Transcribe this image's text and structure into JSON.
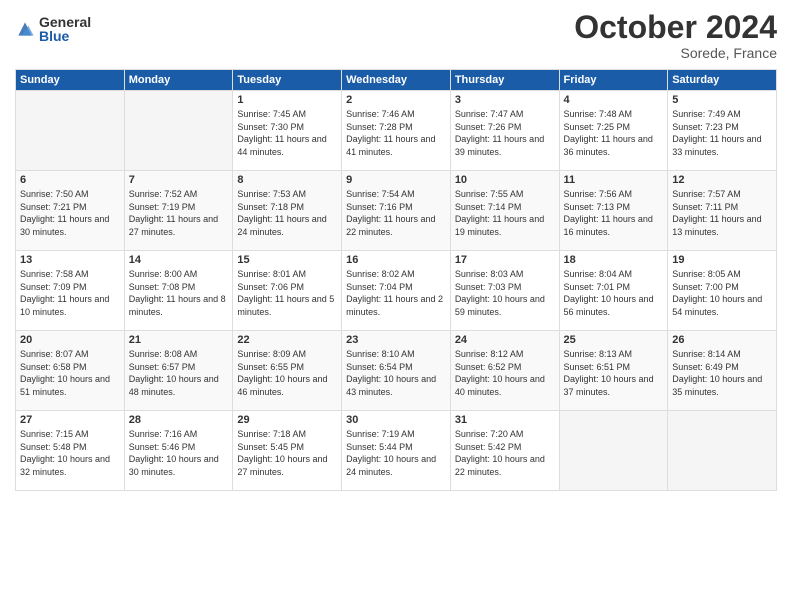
{
  "header": {
    "logo_general": "General",
    "logo_blue": "Blue",
    "month_title": "October 2024",
    "location": "Sorede, France"
  },
  "days_of_week": [
    "Sunday",
    "Monday",
    "Tuesday",
    "Wednesday",
    "Thursday",
    "Friday",
    "Saturday"
  ],
  "weeks": [
    [
      {
        "day": "",
        "empty": true
      },
      {
        "day": "",
        "empty": true
      },
      {
        "day": "1",
        "sunrise": "Sunrise: 7:45 AM",
        "sunset": "Sunset: 7:30 PM",
        "daylight": "Daylight: 11 hours and 44 minutes."
      },
      {
        "day": "2",
        "sunrise": "Sunrise: 7:46 AM",
        "sunset": "Sunset: 7:28 PM",
        "daylight": "Daylight: 11 hours and 41 minutes."
      },
      {
        "day": "3",
        "sunrise": "Sunrise: 7:47 AM",
        "sunset": "Sunset: 7:26 PM",
        "daylight": "Daylight: 11 hours and 39 minutes."
      },
      {
        "day": "4",
        "sunrise": "Sunrise: 7:48 AM",
        "sunset": "Sunset: 7:25 PM",
        "daylight": "Daylight: 11 hours and 36 minutes."
      },
      {
        "day": "5",
        "sunrise": "Sunrise: 7:49 AM",
        "sunset": "Sunset: 7:23 PM",
        "daylight": "Daylight: 11 hours and 33 minutes."
      }
    ],
    [
      {
        "day": "6",
        "sunrise": "Sunrise: 7:50 AM",
        "sunset": "Sunset: 7:21 PM",
        "daylight": "Daylight: 11 hours and 30 minutes."
      },
      {
        "day": "7",
        "sunrise": "Sunrise: 7:52 AM",
        "sunset": "Sunset: 7:19 PM",
        "daylight": "Daylight: 11 hours and 27 minutes."
      },
      {
        "day": "8",
        "sunrise": "Sunrise: 7:53 AM",
        "sunset": "Sunset: 7:18 PM",
        "daylight": "Daylight: 11 hours and 24 minutes."
      },
      {
        "day": "9",
        "sunrise": "Sunrise: 7:54 AM",
        "sunset": "Sunset: 7:16 PM",
        "daylight": "Daylight: 11 hours and 22 minutes."
      },
      {
        "day": "10",
        "sunrise": "Sunrise: 7:55 AM",
        "sunset": "Sunset: 7:14 PM",
        "daylight": "Daylight: 11 hours and 19 minutes."
      },
      {
        "day": "11",
        "sunrise": "Sunrise: 7:56 AM",
        "sunset": "Sunset: 7:13 PM",
        "daylight": "Daylight: 11 hours and 16 minutes."
      },
      {
        "day": "12",
        "sunrise": "Sunrise: 7:57 AM",
        "sunset": "Sunset: 7:11 PM",
        "daylight": "Daylight: 11 hours and 13 minutes."
      }
    ],
    [
      {
        "day": "13",
        "sunrise": "Sunrise: 7:58 AM",
        "sunset": "Sunset: 7:09 PM",
        "daylight": "Daylight: 11 hours and 10 minutes."
      },
      {
        "day": "14",
        "sunrise": "Sunrise: 8:00 AM",
        "sunset": "Sunset: 7:08 PM",
        "daylight": "Daylight: 11 hours and 8 minutes."
      },
      {
        "day": "15",
        "sunrise": "Sunrise: 8:01 AM",
        "sunset": "Sunset: 7:06 PM",
        "daylight": "Daylight: 11 hours and 5 minutes."
      },
      {
        "day": "16",
        "sunrise": "Sunrise: 8:02 AM",
        "sunset": "Sunset: 7:04 PM",
        "daylight": "Daylight: 11 hours and 2 minutes."
      },
      {
        "day": "17",
        "sunrise": "Sunrise: 8:03 AM",
        "sunset": "Sunset: 7:03 PM",
        "daylight": "Daylight: 10 hours and 59 minutes."
      },
      {
        "day": "18",
        "sunrise": "Sunrise: 8:04 AM",
        "sunset": "Sunset: 7:01 PM",
        "daylight": "Daylight: 10 hours and 56 minutes."
      },
      {
        "day": "19",
        "sunrise": "Sunrise: 8:05 AM",
        "sunset": "Sunset: 7:00 PM",
        "daylight": "Daylight: 10 hours and 54 minutes."
      }
    ],
    [
      {
        "day": "20",
        "sunrise": "Sunrise: 8:07 AM",
        "sunset": "Sunset: 6:58 PM",
        "daylight": "Daylight: 10 hours and 51 minutes."
      },
      {
        "day": "21",
        "sunrise": "Sunrise: 8:08 AM",
        "sunset": "Sunset: 6:57 PM",
        "daylight": "Daylight: 10 hours and 48 minutes."
      },
      {
        "day": "22",
        "sunrise": "Sunrise: 8:09 AM",
        "sunset": "Sunset: 6:55 PM",
        "daylight": "Daylight: 10 hours and 46 minutes."
      },
      {
        "day": "23",
        "sunrise": "Sunrise: 8:10 AM",
        "sunset": "Sunset: 6:54 PM",
        "daylight": "Daylight: 10 hours and 43 minutes."
      },
      {
        "day": "24",
        "sunrise": "Sunrise: 8:12 AM",
        "sunset": "Sunset: 6:52 PM",
        "daylight": "Daylight: 10 hours and 40 minutes."
      },
      {
        "day": "25",
        "sunrise": "Sunrise: 8:13 AM",
        "sunset": "Sunset: 6:51 PM",
        "daylight": "Daylight: 10 hours and 37 minutes."
      },
      {
        "day": "26",
        "sunrise": "Sunrise: 8:14 AM",
        "sunset": "Sunset: 6:49 PM",
        "daylight": "Daylight: 10 hours and 35 minutes."
      }
    ],
    [
      {
        "day": "27",
        "sunrise": "Sunrise: 7:15 AM",
        "sunset": "Sunset: 5:48 PM",
        "daylight": "Daylight: 10 hours and 32 minutes."
      },
      {
        "day": "28",
        "sunrise": "Sunrise: 7:16 AM",
        "sunset": "Sunset: 5:46 PM",
        "daylight": "Daylight: 10 hours and 30 minutes."
      },
      {
        "day": "29",
        "sunrise": "Sunrise: 7:18 AM",
        "sunset": "Sunset: 5:45 PM",
        "daylight": "Daylight: 10 hours and 27 minutes."
      },
      {
        "day": "30",
        "sunrise": "Sunrise: 7:19 AM",
        "sunset": "Sunset: 5:44 PM",
        "daylight": "Daylight: 10 hours and 24 minutes."
      },
      {
        "day": "31",
        "sunrise": "Sunrise: 7:20 AM",
        "sunset": "Sunset: 5:42 PM",
        "daylight": "Daylight: 10 hours and 22 minutes."
      },
      {
        "day": "",
        "empty": true
      },
      {
        "day": "",
        "empty": true
      }
    ]
  ]
}
